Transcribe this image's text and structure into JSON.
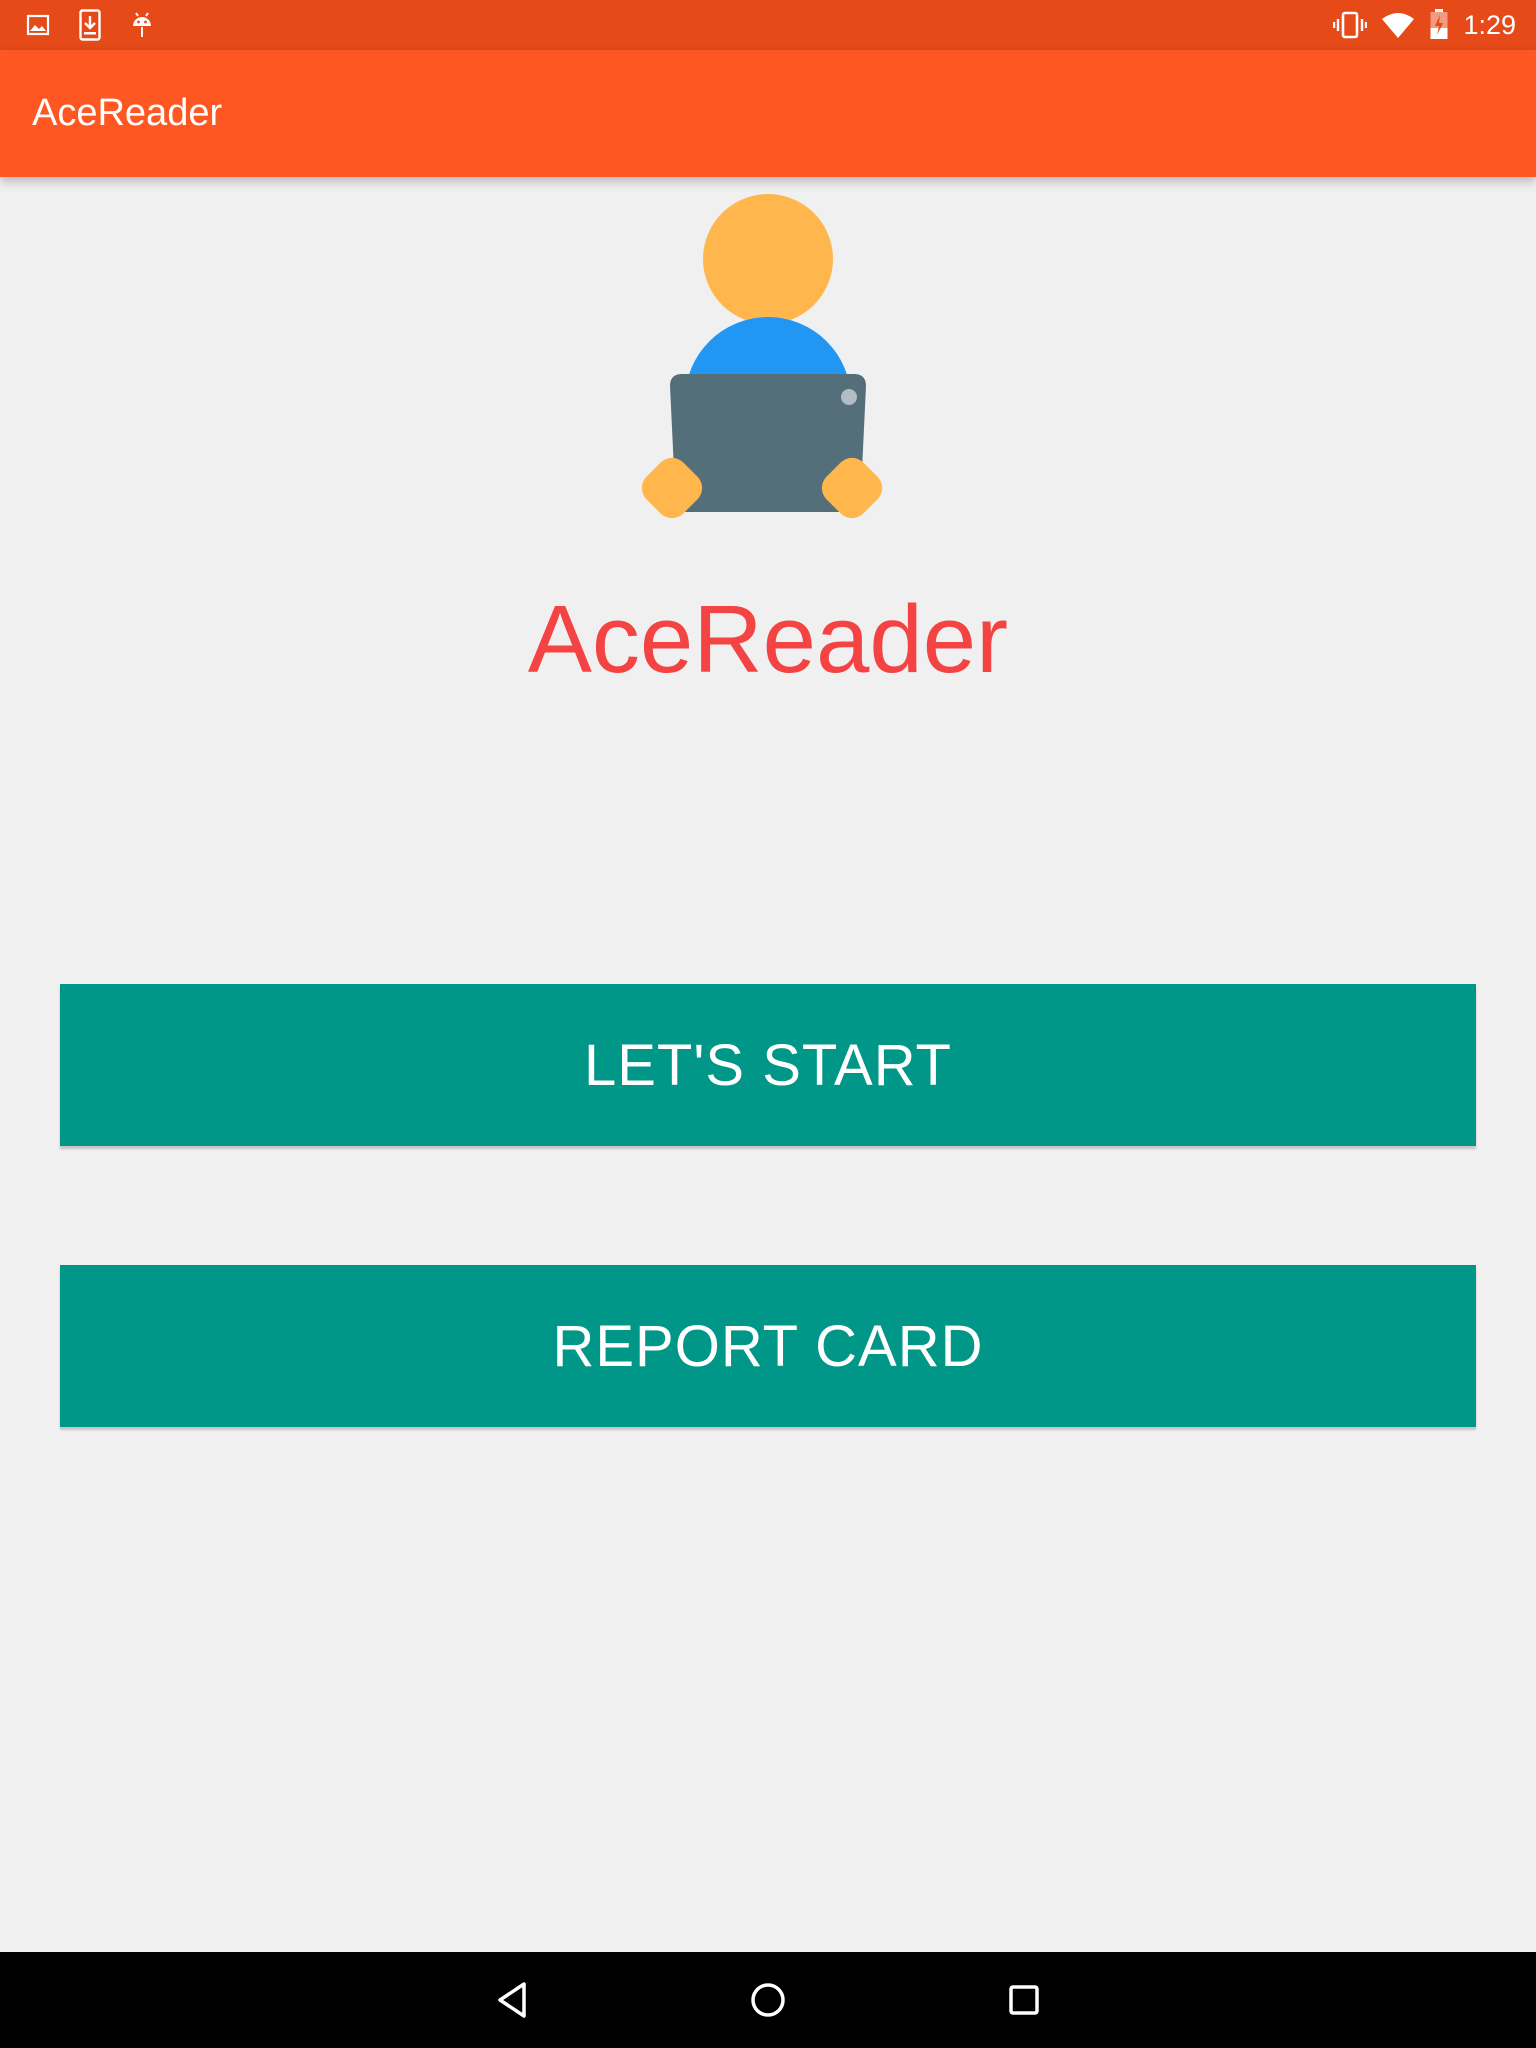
{
  "status_bar": {
    "time": "1:29",
    "left_icons": [
      "image-icon",
      "download-icon",
      "android-debug-icon"
    ],
    "right_icons": [
      "vibrate-icon",
      "wifi-icon",
      "battery-icon"
    ]
  },
  "app_bar": {
    "title": "AceReader"
  },
  "main": {
    "app_name": "AceReader",
    "buttons": {
      "start_label": "LET'S START",
      "report_label": "REPORT CARD"
    }
  },
  "nav_bar": {
    "buttons": [
      "back-icon",
      "home-icon",
      "recents-icon"
    ]
  },
  "colors": {
    "status_bar": "#e64a19",
    "app_bar": "#ff5722",
    "app_name": "#f44343",
    "button": "#009688",
    "background": "#f0f0f0"
  }
}
